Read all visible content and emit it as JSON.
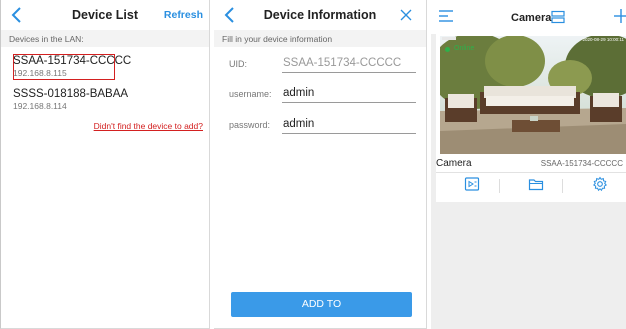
{
  "device_list": {
    "title": "Device List",
    "refresh_label": "Refresh",
    "section_label": "Devices in the LAN:",
    "devices": [
      {
        "name": "SSAA-151734-CCCCC",
        "ip": "192.168.8.115",
        "highlighted": true
      },
      {
        "name": "SSSS-018188-BABAA",
        "ip": "192.168.8.114",
        "highlighted": false
      }
    ],
    "not_found_link": "Didn't find the device to add?"
  },
  "device_info": {
    "title": "Device Information",
    "fill_label": "Fill in your device information",
    "uid_label": "UID:",
    "uid_value": "SSAA-151734-CCCCC",
    "username_label": "username:",
    "username_value": "admin",
    "password_label": "password:",
    "password_value": "admin",
    "add_button": "ADD TO"
  },
  "camera": {
    "title": "Camera",
    "status": "Online",
    "timestamp": "2020-08-29 10:00:11",
    "card_name": "Camera",
    "card_uid": "SSAA-151734-CCCCC",
    "actions": [
      "playback-icon",
      "folder-icon",
      "settings-icon"
    ]
  },
  "colors": {
    "accent": "#2a8fe0",
    "button": "#3a9ae8",
    "highlight_border": "#d32020",
    "online": "#2db14b"
  }
}
